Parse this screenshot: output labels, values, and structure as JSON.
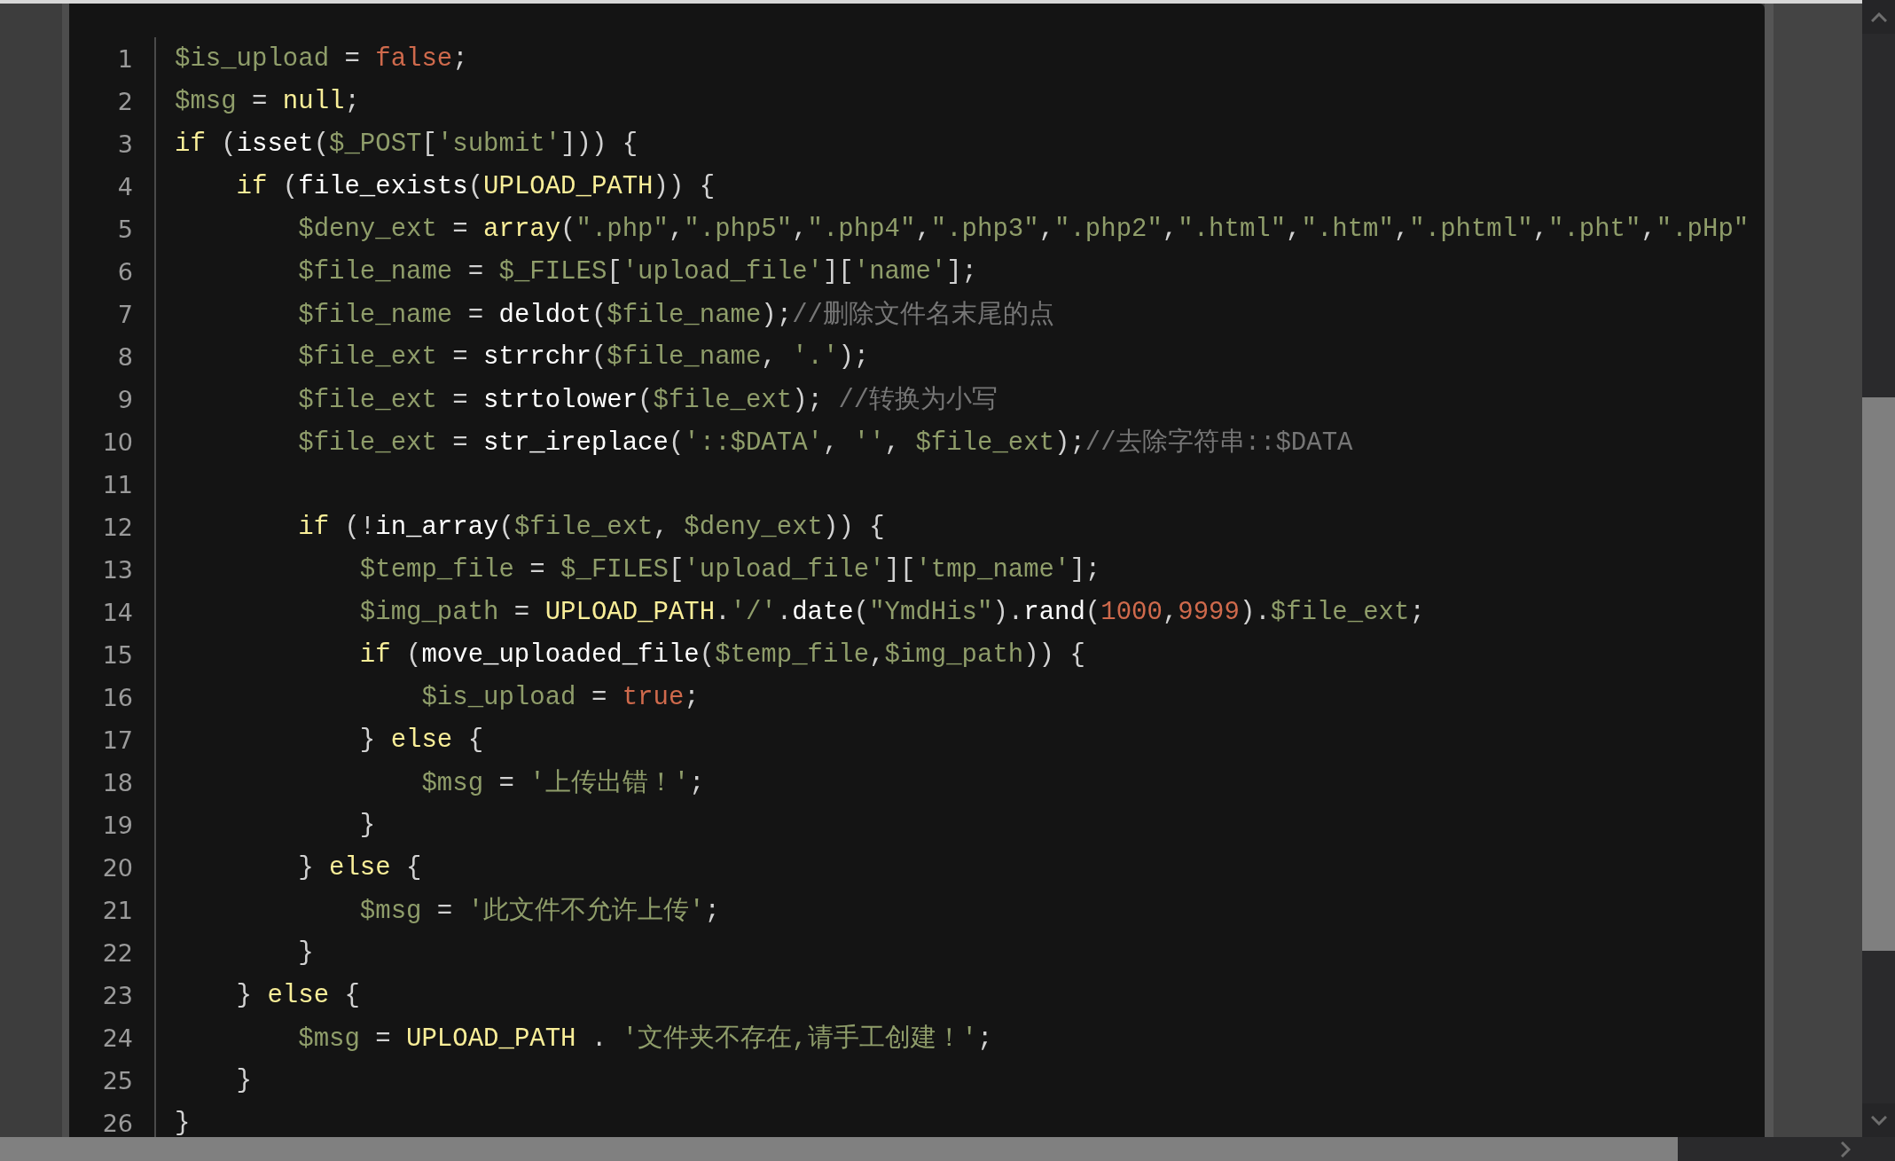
{
  "editor": {
    "lines": [
      {
        "number": "1",
        "tokens": [
          {
            "kind": "var",
            "text": "$is_upload"
          },
          {
            "kind": "op",
            "text": " = "
          },
          {
            "kind": "num",
            "text": "false"
          },
          {
            "kind": "op",
            "text": ";"
          }
        ]
      },
      {
        "number": "2",
        "tokens": [
          {
            "kind": "var",
            "text": "$msg"
          },
          {
            "kind": "op",
            "text": " = "
          },
          {
            "kind": "kw",
            "text": "null"
          },
          {
            "kind": "op",
            "text": ";"
          }
        ]
      },
      {
        "number": "3",
        "tokens": [
          {
            "kind": "kw",
            "text": "if"
          },
          {
            "kind": "op",
            "text": " ("
          },
          {
            "kind": "fn",
            "text": "isset"
          },
          {
            "kind": "op",
            "text": "("
          },
          {
            "kind": "var",
            "text": "$_POST"
          },
          {
            "kind": "op",
            "text": "["
          },
          {
            "kind": "str",
            "text": "'submit'"
          },
          {
            "kind": "op",
            "text": "])) {"
          }
        ]
      },
      {
        "number": "4",
        "tokens": [
          {
            "kind": "kw",
            "text": "    if"
          },
          {
            "kind": "op",
            "text": " ("
          },
          {
            "kind": "fn",
            "text": "file_exists"
          },
          {
            "kind": "op",
            "text": "("
          },
          {
            "kind": "const",
            "text": "UPLOAD_PATH"
          },
          {
            "kind": "op",
            "text": ")) {"
          }
        ]
      },
      {
        "number": "5",
        "tokens": [
          {
            "kind": "var",
            "text": "        $deny_ext"
          },
          {
            "kind": "op",
            "text": " = "
          },
          {
            "kind": "kw",
            "text": "array"
          },
          {
            "kind": "op",
            "text": "("
          },
          {
            "kind": "str",
            "text": "\".php\""
          },
          {
            "kind": "op",
            "text": ","
          },
          {
            "kind": "str",
            "text": "\".php5\""
          },
          {
            "kind": "op",
            "text": ","
          },
          {
            "kind": "str",
            "text": "\".php4\""
          },
          {
            "kind": "op",
            "text": ","
          },
          {
            "kind": "str",
            "text": "\".php3\""
          },
          {
            "kind": "op",
            "text": ","
          },
          {
            "kind": "str",
            "text": "\".php2\""
          },
          {
            "kind": "op",
            "text": ","
          },
          {
            "kind": "str",
            "text": "\".html\""
          },
          {
            "kind": "op",
            "text": ","
          },
          {
            "kind": "str",
            "text": "\".htm\""
          },
          {
            "kind": "op",
            "text": ","
          },
          {
            "kind": "str",
            "text": "\".phtml\""
          },
          {
            "kind": "op",
            "text": ","
          },
          {
            "kind": "str",
            "text": "\".pht\""
          },
          {
            "kind": "op",
            "text": ","
          },
          {
            "kind": "str",
            "text": "\".pHp\""
          }
        ]
      },
      {
        "number": "6",
        "tokens": [
          {
            "kind": "var",
            "text": "        $file_name"
          },
          {
            "kind": "op",
            "text": " = "
          },
          {
            "kind": "var",
            "text": "$_FILES"
          },
          {
            "kind": "op",
            "text": "["
          },
          {
            "kind": "str",
            "text": "'upload_file'"
          },
          {
            "kind": "op",
            "text": "]["
          },
          {
            "kind": "str",
            "text": "'name'"
          },
          {
            "kind": "op",
            "text": "];"
          }
        ]
      },
      {
        "number": "7",
        "tokens": [
          {
            "kind": "var",
            "text": "        $file_name"
          },
          {
            "kind": "op",
            "text": " = "
          },
          {
            "kind": "fn",
            "text": "deldot"
          },
          {
            "kind": "op",
            "text": "("
          },
          {
            "kind": "var",
            "text": "$file_name"
          },
          {
            "kind": "op",
            "text": ");"
          },
          {
            "kind": "cmt",
            "text": "//删除文件名末尾的点"
          }
        ]
      },
      {
        "number": "8",
        "tokens": [
          {
            "kind": "var",
            "text": "        $file_ext"
          },
          {
            "kind": "op",
            "text": " = "
          },
          {
            "kind": "fn",
            "text": "strrchr"
          },
          {
            "kind": "op",
            "text": "("
          },
          {
            "kind": "var",
            "text": "$file_name"
          },
          {
            "kind": "op",
            "text": ", "
          },
          {
            "kind": "str",
            "text": "'.'"
          },
          {
            "kind": "op",
            "text": ");"
          }
        ]
      },
      {
        "number": "9",
        "tokens": [
          {
            "kind": "var",
            "text": "        $file_ext"
          },
          {
            "kind": "op",
            "text": " = "
          },
          {
            "kind": "fn",
            "text": "strtolower"
          },
          {
            "kind": "op",
            "text": "("
          },
          {
            "kind": "var",
            "text": "$file_ext"
          },
          {
            "kind": "op",
            "text": "); "
          },
          {
            "kind": "cmt",
            "text": "//转换为小写"
          }
        ]
      },
      {
        "number": "10",
        "tokens": [
          {
            "kind": "var",
            "text": "        $file_ext"
          },
          {
            "kind": "op",
            "text": " = "
          },
          {
            "kind": "fn",
            "text": "str_ireplace"
          },
          {
            "kind": "op",
            "text": "("
          },
          {
            "kind": "str",
            "text": "'::$DATA'"
          },
          {
            "kind": "op",
            "text": ", "
          },
          {
            "kind": "str",
            "text": "''"
          },
          {
            "kind": "op",
            "text": ", "
          },
          {
            "kind": "var",
            "text": "$file_ext"
          },
          {
            "kind": "op",
            "text": ");"
          },
          {
            "kind": "cmt",
            "text": "//去除字符串::$DATA"
          }
        ]
      },
      {
        "number": "11"
      },
      {
        "number": "12",
        "tokens": [
          {
            "kind": "kw",
            "text": "        if"
          },
          {
            "kind": "op",
            "text": " (!"
          },
          {
            "kind": "fn",
            "text": "in_array"
          },
          {
            "kind": "op",
            "text": "("
          },
          {
            "kind": "var",
            "text": "$file_ext"
          },
          {
            "kind": "op",
            "text": ", "
          },
          {
            "kind": "var",
            "text": "$deny_ext"
          },
          {
            "kind": "op",
            "text": ")) {"
          }
        ]
      },
      {
        "number": "13",
        "tokens": [
          {
            "kind": "var",
            "text": "            $temp_file"
          },
          {
            "kind": "op",
            "text": " = "
          },
          {
            "kind": "var",
            "text": "$_FILES"
          },
          {
            "kind": "op",
            "text": "["
          },
          {
            "kind": "str",
            "text": "'upload_file'"
          },
          {
            "kind": "op",
            "text": "]["
          },
          {
            "kind": "str",
            "text": "'tmp_name'"
          },
          {
            "kind": "op",
            "text": "];"
          }
        ]
      },
      {
        "number": "14",
        "tokens": [
          {
            "kind": "var",
            "text": "            $img_path"
          },
          {
            "kind": "op",
            "text": " = "
          },
          {
            "kind": "const",
            "text": "UPLOAD_PATH"
          },
          {
            "kind": "op",
            "text": "."
          },
          {
            "kind": "str",
            "text": "'/'"
          },
          {
            "kind": "op",
            "text": "."
          },
          {
            "kind": "fn",
            "text": "date"
          },
          {
            "kind": "op",
            "text": "("
          },
          {
            "kind": "str",
            "text": "\"YmdHis\""
          },
          {
            "kind": "op",
            "text": ")."
          },
          {
            "kind": "fn",
            "text": "rand"
          },
          {
            "kind": "op",
            "text": "("
          },
          {
            "kind": "num",
            "text": "1000"
          },
          {
            "kind": "op",
            "text": ","
          },
          {
            "kind": "num",
            "text": "9999"
          },
          {
            "kind": "op",
            "text": ")."
          },
          {
            "kind": "var",
            "text": "$file_ext"
          },
          {
            "kind": "op",
            "text": ";"
          }
        ]
      },
      {
        "number": "15",
        "tokens": [
          {
            "kind": "kw",
            "text": "            if"
          },
          {
            "kind": "op",
            "text": " ("
          },
          {
            "kind": "fn",
            "text": "move_uploaded_file"
          },
          {
            "kind": "op",
            "text": "("
          },
          {
            "kind": "var",
            "text": "$temp_file"
          },
          {
            "kind": "op",
            "text": ","
          },
          {
            "kind": "var",
            "text": "$img_path"
          },
          {
            "kind": "op",
            "text": ")) {"
          }
        ]
      },
      {
        "number": "16",
        "tokens": [
          {
            "kind": "var",
            "text": "                $is_upload"
          },
          {
            "kind": "op",
            "text": " = "
          },
          {
            "kind": "num",
            "text": "true"
          },
          {
            "kind": "op",
            "text": ";"
          }
        ]
      },
      {
        "number": "17",
        "tokens": [
          {
            "kind": "op",
            "text": "            } "
          },
          {
            "kind": "kw",
            "text": "else"
          },
          {
            "kind": "op",
            "text": " {"
          }
        ]
      },
      {
        "number": "18",
        "tokens": [
          {
            "kind": "var",
            "text": "                $msg"
          },
          {
            "kind": "op",
            "text": " = "
          },
          {
            "kind": "str",
            "text": "'上传出错！'"
          },
          {
            "kind": "op",
            "text": ";"
          }
        ]
      },
      {
        "number": "19",
        "tokens": [
          {
            "kind": "op",
            "text": "            }"
          }
        ]
      },
      {
        "number": "20",
        "tokens": [
          {
            "kind": "op",
            "text": "        } "
          },
          {
            "kind": "kw",
            "text": "else"
          },
          {
            "kind": "op",
            "text": " {"
          }
        ]
      },
      {
        "number": "21",
        "tokens": [
          {
            "kind": "var",
            "text": "            $msg"
          },
          {
            "kind": "op",
            "text": " = "
          },
          {
            "kind": "str",
            "text": "'此文件不允许上传'"
          },
          {
            "kind": "op",
            "text": ";"
          }
        ]
      },
      {
        "number": "22",
        "tokens": [
          {
            "kind": "op",
            "text": "        }"
          }
        ]
      },
      {
        "number": "23",
        "tokens": [
          {
            "kind": "op",
            "text": "    } "
          },
          {
            "kind": "kw",
            "text": "else"
          },
          {
            "kind": "op",
            "text": " {"
          }
        ]
      },
      {
        "number": "24",
        "tokens": [
          {
            "kind": "var",
            "text": "        $msg"
          },
          {
            "kind": "op",
            "text": " = "
          },
          {
            "kind": "const",
            "text": "UPLOAD_PATH"
          },
          {
            "kind": "op",
            "text": " . "
          },
          {
            "kind": "str",
            "text": "'文件夹不存在,请手工创建！'"
          },
          {
            "kind": "op",
            "text": ";"
          }
        ]
      },
      {
        "number": "25",
        "tokens": [
          {
            "kind": "op",
            "text": "    }"
          }
        ]
      },
      {
        "number": "26",
        "tokens": [
          {
            "kind": "op",
            "text": "}"
          }
        ]
      }
    ]
  }
}
